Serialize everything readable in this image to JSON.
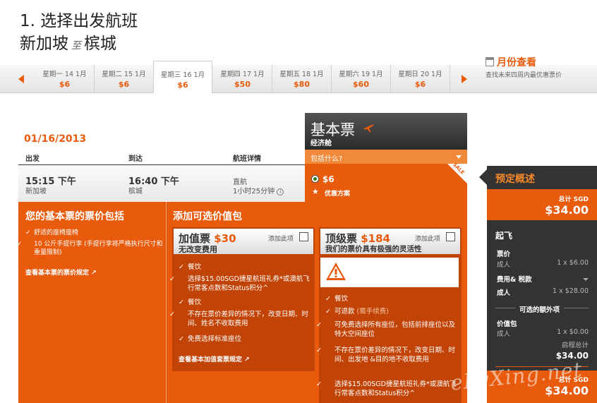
{
  "header": {
    "step_title": "1. 选择出发航班",
    "origin": "新加坡",
    "route_sep": "至",
    "destination": "槟城"
  },
  "date_strip": {
    "days": [
      {
        "label": "星期一 14 1月",
        "price": "$6"
      },
      {
        "label": "星期二 15 1月",
        "price": "$6"
      },
      {
        "label": "星期三 16 1月",
        "price": "$6",
        "selected": true
      },
      {
        "label": "星期四 17 1月",
        "price": "$50"
      },
      {
        "label": "星期五 18 1月",
        "price": "$80"
      },
      {
        "label": "星期六 19 1月",
        "price": "$60"
      },
      {
        "label": "星期日 20 1月",
        "price": "$6"
      }
    ]
  },
  "calendar_link": {
    "title": "月份查看",
    "subtitle": "查找未来四周内最优惠票价"
  },
  "flight": {
    "date": "01/16/2013",
    "headers": {
      "depart": "出发",
      "arrive": "到达",
      "details": "航班详情"
    },
    "depart_time": "15:15 下午",
    "depart_city": "新加坡",
    "arrive_time": "16:40 下午",
    "arrive_city": "槟城",
    "type": "直航",
    "duration": "1小时25分钟"
  },
  "fare": {
    "title": "基本票",
    "class": "经济舱",
    "includes_link": "包括什么?",
    "price": "$6",
    "promo": "优惠方案",
    "sale_tag": "SALE"
  },
  "included": {
    "title": "您的基本票的票价包括",
    "items": [
      "舒适的座椅座椅",
      "10 公斤手提行李 (手提行李将严格执行尺寸和重量限制)"
    ],
    "link": "查看基本票的票价规定"
  },
  "addons": {
    "title": "添加可选价值包",
    "add_label": "添加此项",
    "value_pack": {
      "name": "加值票",
      "price": "$30",
      "desc": "无改变费用",
      "items": [
        "餐饮",
        "选择$15.00SGD捷星航班礼券*或澳航飞行常客点数和Status积分^",
        "餐饮",
        "不存在票价差异的情况下，改变日期、时间、姓名不收取费用",
        "免费选择标准座位"
      ],
      "link": "查看基本加值套票规定"
    },
    "top_pack": {
      "name": "顶级票",
      "price": "$184",
      "desc": "我们的票价具有极强的灵活性",
      "items": [
        "餐饮",
        "可退款",
        "(需手续费)",
        "可免费选择所有座位，包括前排座位以及特大空间座位",
        "不存在票价差异的情况下，改变日期、时间、出发地 &目的地不收取费用",
        "选择$15.00SGD捷星航班礼券*或澳航飞行常客点数和Status积分^"
      ]
    }
  },
  "summary": {
    "title": "预定概述",
    "total_label": "总计 SGD",
    "total": "$34.00",
    "section": "起飞",
    "fare_label": "票价",
    "adult_label": "成人",
    "fare_qty": "1 x $6.00",
    "fees_label": "费用& 税款",
    "fees_adult": "成人",
    "fees_qty": "1 x $28.00",
    "optional_label": "可选的额外项",
    "value_label": "价值包",
    "value_adult": "成人",
    "value_qty": "1 x $0.00",
    "subtotal_label": "启程总计",
    "subtotal": "$34.00",
    "total2_label": "总计 SGD",
    "total2": "$34.00"
  },
  "watermark": "eLvXing.net",
  "colors": {
    "accent": "#e85a0c",
    "dark": "#333333"
  }
}
